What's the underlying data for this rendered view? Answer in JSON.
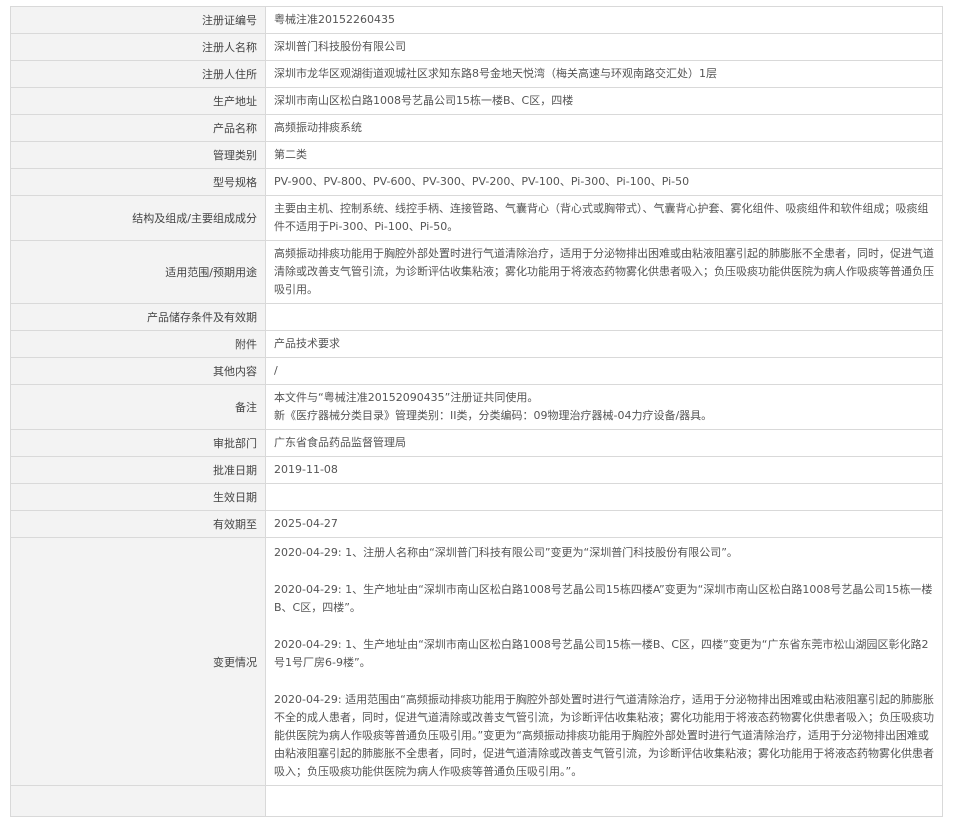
{
  "rows": [
    {
      "label": "注册证编号",
      "value": "粤械注准20152260435"
    },
    {
      "label": "注册人名称",
      "value": "深圳普门科技股份有限公司"
    },
    {
      "label": "注册人住所",
      "value": "深圳市龙华区观湖街道观城社区求知东路8号金地天悦湾（梅关高速与环观南路交汇处）1层"
    },
    {
      "label": "生产地址",
      "value": "深圳市南山区松白路1008号艺晶公司15栋一楼B、C区，四楼"
    },
    {
      "label": "产品名称",
      "value": "高频振动排痰系统"
    },
    {
      "label": "管理类别",
      "value": "第二类"
    },
    {
      "label": "型号规格",
      "value": "PV-900、PV-800、PV-600、PV-300、PV-200、PV-100、Pi-300、Pi-100、Pi-50"
    },
    {
      "label": "结构及组成/主要组成成分",
      "value": "主要由主机、控制系统、线控手柄、连接管路、气囊背心（背心式或胸带式）、气囊背心护套、雾化组件、吸痰组件和软件组成；吸痰组件不适用于Pi-300、Pi-100、Pi-50。"
    },
    {
      "label": "适用范围/预期用途",
      "value": "高频振动排痰功能用于胸腔外部处置时进行气道清除治疗，适用于分泌物排出困难或由粘液阻塞引起的肺膨胀不全患者，同时，促进气道清除或改善支气管引流，为诊断评估收集粘液；雾化功能用于将液态药物雾化供患者吸入；负压吸痰功能供医院为病人作吸痰等普通负压吸引用。"
    },
    {
      "label": "产品储存条件及有效期",
      "value": ""
    },
    {
      "label": "附件",
      "value": "产品技术要求"
    },
    {
      "label": "其他内容",
      "value": "/"
    },
    {
      "label": "备注",
      "lines": [
        "本文件与“粤械注准20152090435”注册证共同使用。",
        "新《医疗器械分类目录》管理类别：II类，分类编码：09物理治疗器械-04力疗设备/器具。"
      ]
    },
    {
      "label": "审批部门",
      "value": "广东省食品药品监督管理局"
    },
    {
      "label": "批准日期",
      "value": "2019-11-08"
    },
    {
      "label": "生效日期",
      "value": ""
    },
    {
      "label": "有效期至",
      "value": "2025-04-27"
    },
    {
      "label": "变更情况",
      "changes": [
        "2020-04-29: 1、注册人名称由“深圳普门科技有限公司”变更为“深圳普门科技股份有限公司”。",
        "2020-04-29: 1、生产地址由“深圳市南山区松白路1008号艺晶公司15栋四楼A”变更为“深圳市南山区松白路1008号艺晶公司15栋一楼B、C区，四楼”。",
        "2020-04-29: 1、生产地址由“深圳市南山区松白路1008号艺晶公司15栋一楼B、C区，四楼”变更为“广东省东莞市松山湖园区彰化路2号1号厂房6-9楼”。",
        "2020-04-29: 适用范围由“高频振动排痰功能用于胸腔外部处置时进行气道清除治疗，适用于分泌物排出困难或由粘液阻塞引起的肺膨胀不全的成人患者，同时，促进气道清除或改善支气管引流，为诊断评估收集粘液；雾化功能用于将液态药物雾化供患者吸入；负压吸痰功能供医院为病人作吸痰等普通负压吸引用。”变更为“高频振动排痰功能用于胸腔外部处置时进行气道清除治疗，适用于分泌物排出困难或由粘液阻塞引起的肺膨胀不全患者，同时，促进气道清除或改善支气管引流，为诊断评估收集粘液；雾化功能用于将液态药物雾化供患者吸入；负压吸痰功能供医院为病人作吸痰等普通负压吸引用。”。"
      ]
    }
  ]
}
